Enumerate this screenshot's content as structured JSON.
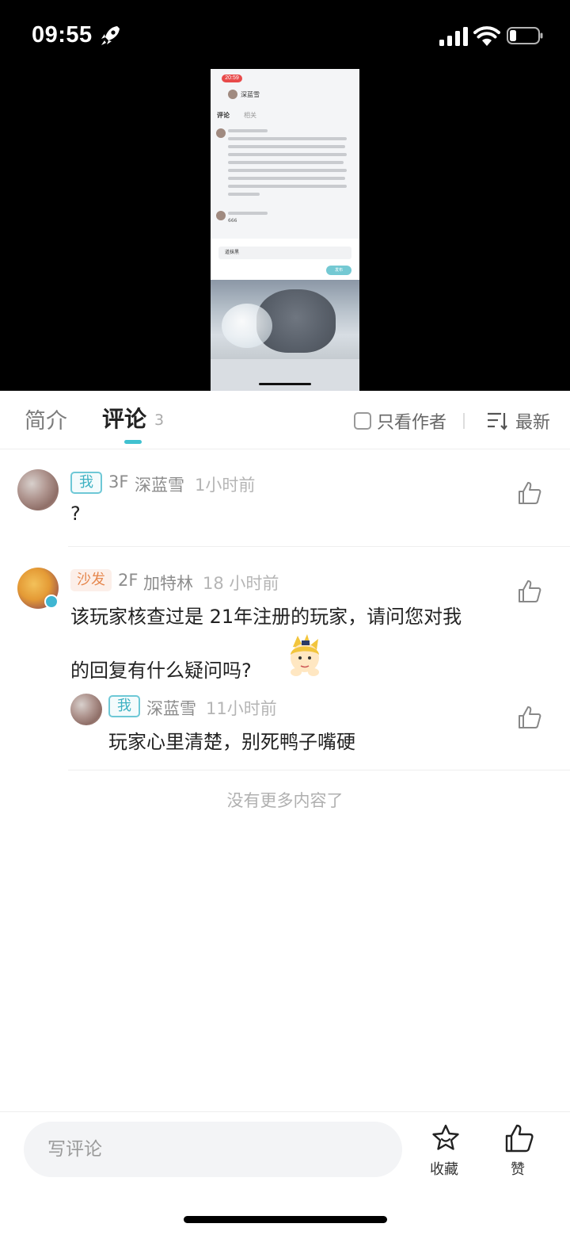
{
  "status_bar": {
    "time": "09:55"
  },
  "video": {
    "inner_time": "20:59",
    "inner_title": "深蓝雪",
    "inner_tab_comments": "评论",
    "inner_tab_related": "相关",
    "inner_input": "道抹黑",
    "inner_send": "发布",
    "inner_reply": "666"
  },
  "tabs": {
    "intro": "简介",
    "comments": "评论",
    "comment_count": "3",
    "author_only": "只看作者",
    "sort": "最新"
  },
  "comments": [
    {
      "badge": "我",
      "floor": "3F",
      "name": "深蓝雪",
      "time": "1小时前",
      "text": "?"
    },
    {
      "badge": "沙发",
      "floor": "2F",
      "name": "加特林",
      "time": "18 小时前",
      "text_line1": "该玩家核查过是 21年注册的玩家，请问您对我",
      "text_line2": "的回复有什么疑问吗?",
      "reply": {
        "badge": "我",
        "name": "深蓝雪",
        "time": "11小时前",
        "text": "玩家心里清楚，别死鸭子嘴硬"
      }
    }
  ],
  "no_more": "没有更多内容了",
  "bottom_bar": {
    "input_placeholder": "写评论",
    "favorite_label": "收藏",
    "like_label": "赞"
  },
  "icons": [
    "rocket-icon",
    "signal-icon",
    "wifi-icon",
    "battery-icon",
    "checkbox-icon",
    "sort-icon",
    "thumbs-up-icon",
    "star-icon"
  ],
  "colors": {
    "accent": "#40c1d0",
    "sofa_badge": "#e6884f"
  }
}
